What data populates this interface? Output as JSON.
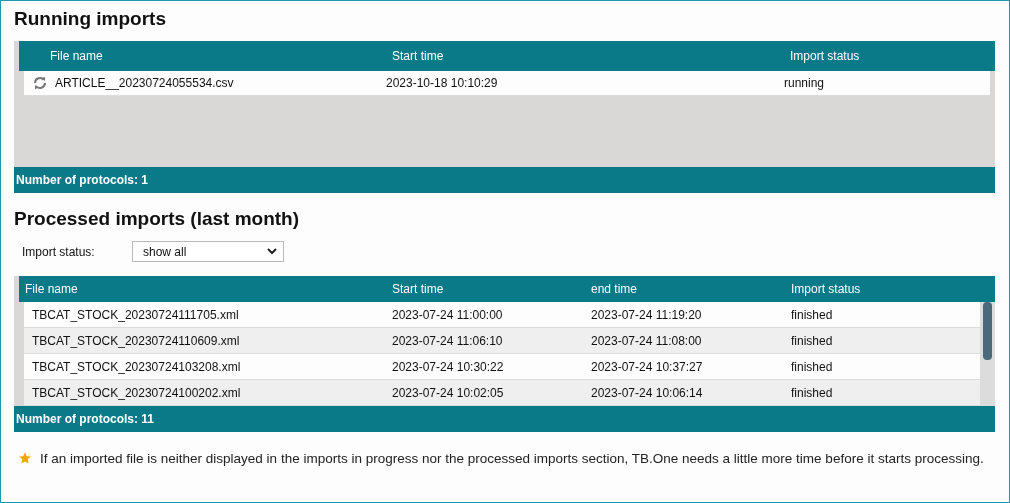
{
  "running_imports": {
    "title": "Running imports",
    "columns": [
      "File name",
      "Start time",
      "Import status"
    ],
    "rows": [
      {
        "file_name": "ARTICLE__20230724055534.csv",
        "start_time": "2023-10-18 10:10:29",
        "import_status": "running"
      }
    ],
    "footer": "Number of protocols: 1"
  },
  "processed_imports": {
    "title": "Processed imports (last month)",
    "filter": {
      "label": "Import status:",
      "value": "show all"
    },
    "columns": [
      "File name",
      "Start time",
      "end time",
      "Import status"
    ],
    "rows": [
      {
        "file_name": "TBCAT_STOCK_20230724111705.xml",
        "start_time": "2023-07-24 11:00:00",
        "end_time": "2023-07-24 11:19:20",
        "import_status": "finished"
      },
      {
        "file_name": "TBCAT_STOCK_20230724110609.xml",
        "start_time": "2023-07-24 11:06:10",
        "end_time": "2023-07-24 11:08:00",
        "import_status": "finished"
      },
      {
        "file_name": "TBCAT_STOCK_20230724103208.xml",
        "start_time": "2023-07-24 10:30:22",
        "end_time": "2023-07-24 10:37:27",
        "import_status": "finished"
      },
      {
        "file_name": "TBCAT_STOCK_20230724100202.xml",
        "start_time": "2023-07-24 10:02:05",
        "end_time": "2023-07-24 10:06:14",
        "import_status": "finished"
      }
    ],
    "footer": "Number of protocols: 11"
  },
  "note": "If an imported file is neither displayed in the imports in progress nor the processed imports section, TB.One needs a little more time before it starts processing."
}
